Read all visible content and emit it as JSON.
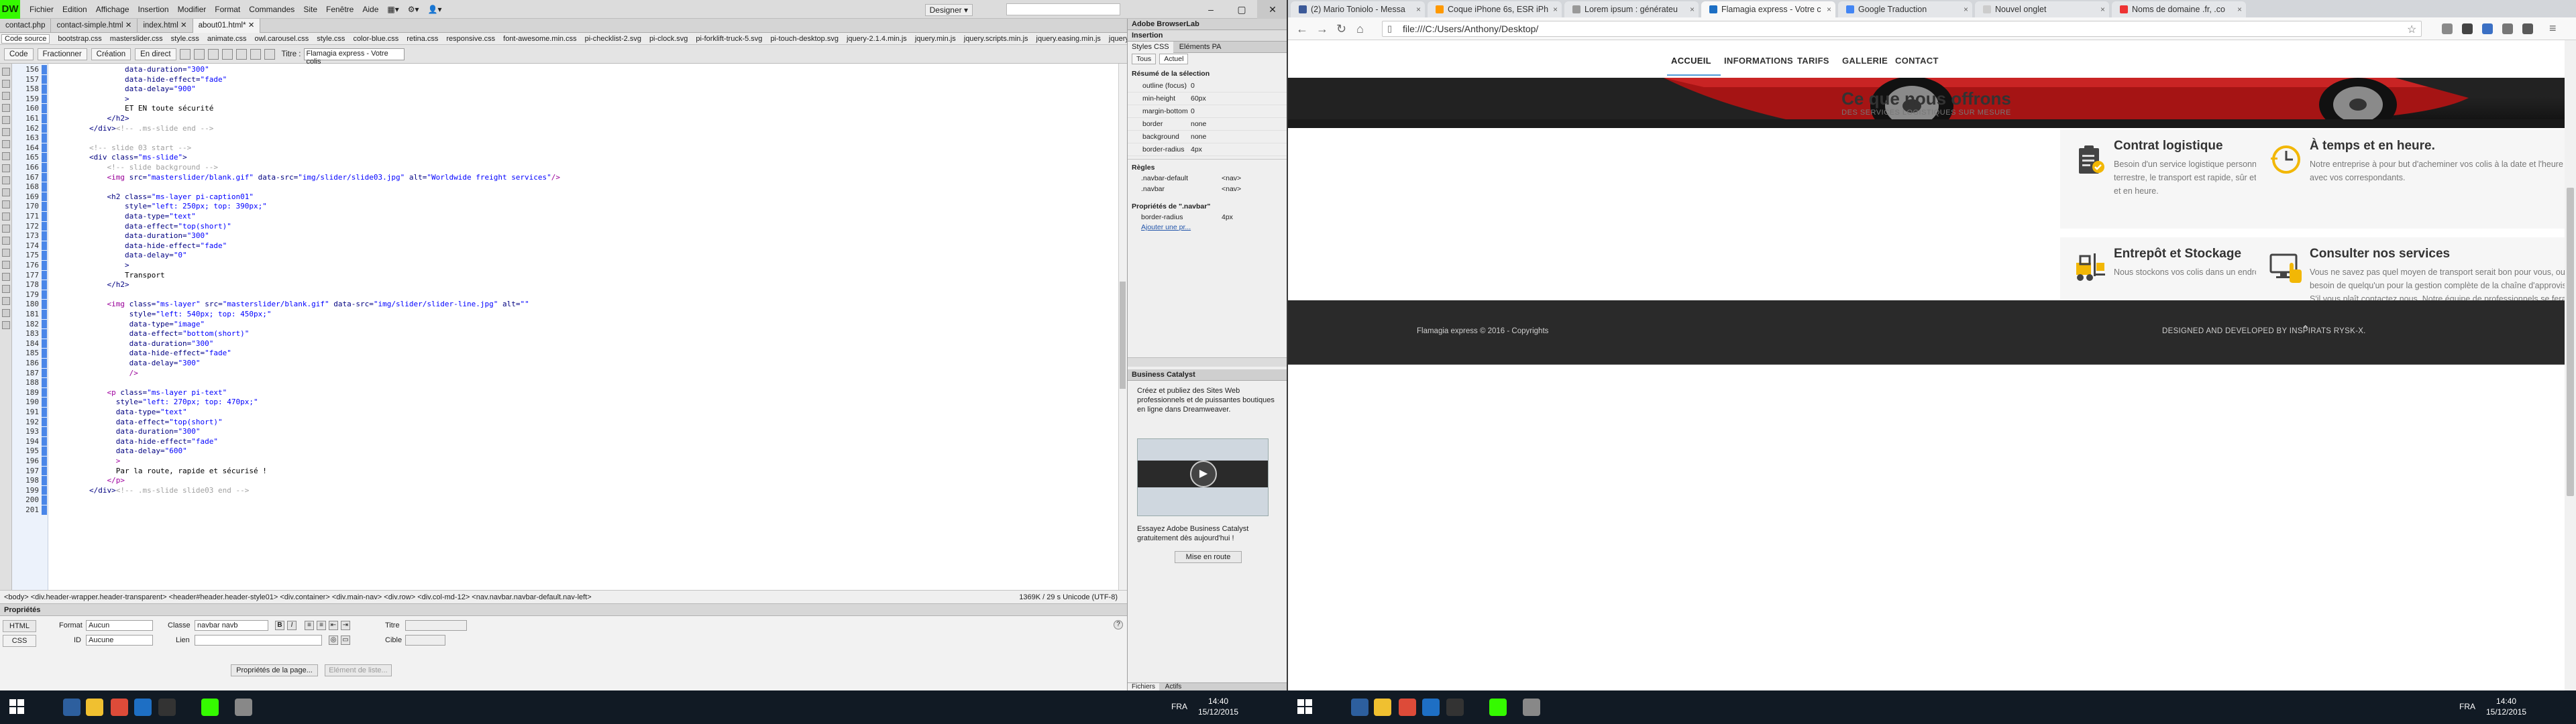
{
  "dreamweaver": {
    "logo": "DW",
    "menus": [
      "Fichier",
      "Edition",
      "Affichage",
      "Insertion",
      "Modifier",
      "Format",
      "Commandes",
      "Site",
      "Fenêtre",
      "Aide"
    ],
    "workspace": "Designer ▾",
    "window_controls": [
      "–",
      "▢",
      "✕"
    ],
    "doc_tabs": [
      "contact.php",
      "contact-simple.html ✕",
      "index.html ✕",
      "about01.html* ✕"
    ],
    "related_files": [
      "Code source",
      "bootstrap.css",
      "masterslider.css",
      "style.css",
      "animate.css",
      "owl.carousel.css",
      "style.css",
      "color-blue.css",
      "retina.css",
      "responsive.css",
      "font-awesome.min.css",
      "pi-checklist-2.svg",
      "pi-clock.svg",
      "pi-forklift-truck-5.svg",
      "pi-touch-desktop.svg",
      "jquery-2.1.4.min.js",
      "jquery.min.js",
      "jquery.scripts.min.js",
      "jquery.easing.min.js",
      "jquery.mcst"
    ],
    "view_buttons": [
      "Code",
      "Fractionner",
      "Création",
      "En direct"
    ],
    "title_label": "Titre :",
    "title_value": "Flamagia express - Votre colis",
    "code_lines": [
      {
        "n": "156",
        "c": [
          [
            "t-attr",
            "                data-duration="
          ],
          [
            "t-str",
            "\"300\""
          ]
        ]
      },
      {
        "n": "157",
        "c": [
          [
            "t-attr",
            "                data-hide-effect="
          ],
          [
            "t-str",
            "\"fade\""
          ]
        ]
      },
      {
        "n": "158",
        "c": [
          [
            "t-attr",
            "                data-delay="
          ],
          [
            "t-str",
            "\"900\""
          ]
        ]
      },
      {
        "n": "159",
        "c": [
          [
            "t-tag",
            "                >"
          ]
        ]
      },
      {
        "n": "160",
        "c": [
          [
            "t-txt",
            "                ET EN toute sécurité"
          ]
        ]
      },
      {
        "n": "161",
        "c": [
          [
            "t-tag",
            "            </h2>"
          ]
        ]
      },
      {
        "n": "162",
        "c": [
          [
            "t-tag",
            "        </div>"
          ],
          [
            "t-cmt",
            "<!-- .ms-slide end -->"
          ]
        ]
      },
      {
        "n": "163",
        "c": [
          [
            "t-txt",
            ""
          ]
        ]
      },
      {
        "n": "164",
        "c": [
          [
            "t-cmt",
            "        <!-- slide 03 start -->"
          ]
        ]
      },
      {
        "n": "165",
        "c": [
          [
            "t-tag",
            "        <div "
          ],
          [
            "t-attr",
            "class="
          ],
          [
            "t-str",
            "\"ms-slide\""
          ],
          [
            "t-tag",
            ">"
          ]
        ]
      },
      {
        "n": "166",
        "c": [
          [
            "t-cmt",
            "            <!-- slide background -->"
          ]
        ]
      },
      {
        "n": "167",
        "c": [
          [
            "t-img",
            "            <img "
          ],
          [
            "t-attr",
            "src="
          ],
          [
            "t-str",
            "\"masterslider/blank.gif\""
          ],
          [
            "t-attr",
            " data-src="
          ],
          [
            "t-str",
            "\"img/slider/slide03.jpg\""
          ],
          [
            "t-attr",
            " alt="
          ],
          [
            "t-str",
            "\"Worldwide freight services\""
          ],
          [
            "t-img",
            "/>"
          ]
        ]
      },
      {
        "n": "168",
        "c": [
          [
            "t-txt",
            ""
          ]
        ]
      },
      {
        "n": "169",
        "c": [
          [
            "t-tag",
            "            <h2 "
          ],
          [
            "t-attr",
            "class="
          ],
          [
            "t-str",
            "\"ms-layer pi-caption01\""
          ]
        ]
      },
      {
        "n": "170",
        "c": [
          [
            "t-attr",
            "                style="
          ],
          [
            "t-str",
            "\"left: 250px; top: 390px;\""
          ]
        ]
      },
      {
        "n": "171",
        "c": [
          [
            "t-attr",
            "                data-type="
          ],
          [
            "t-str",
            "\"text\""
          ]
        ]
      },
      {
        "n": "172",
        "c": [
          [
            "t-attr",
            "                data-effect="
          ],
          [
            "t-str",
            "\"top(short)\""
          ]
        ]
      },
      {
        "n": "173",
        "c": [
          [
            "t-attr",
            "                data-duration="
          ],
          [
            "t-str",
            "\"300\""
          ]
        ]
      },
      {
        "n": "174",
        "c": [
          [
            "t-attr",
            "                data-hide-effect="
          ],
          [
            "t-str",
            "\"fade\""
          ]
        ]
      },
      {
        "n": "175",
        "c": [
          [
            "t-attr",
            "                data-delay="
          ],
          [
            "t-str",
            "\"0\""
          ]
        ]
      },
      {
        "n": "176",
        "c": [
          [
            "t-tag",
            "                >"
          ]
        ]
      },
      {
        "n": "177",
        "c": [
          [
            "t-txt",
            "                Transport"
          ]
        ]
      },
      {
        "n": "178",
        "c": [
          [
            "t-tag",
            "            </h2>"
          ]
        ]
      },
      {
        "n": "179",
        "c": [
          [
            "t-txt",
            ""
          ]
        ]
      },
      {
        "n": "180",
        "c": [
          [
            "t-img",
            "            <img "
          ],
          [
            "t-attr",
            "class="
          ],
          [
            "t-str",
            "\"ms-layer\""
          ],
          [
            "t-attr",
            " src="
          ],
          [
            "t-str",
            "\"masterslider/blank.gif\""
          ],
          [
            "t-attr",
            " data-src="
          ],
          [
            "t-str",
            "\"img/slider/slider-line.jpg\""
          ],
          [
            "t-attr",
            " alt="
          ],
          [
            "t-str",
            "\"\""
          ]
        ]
      },
      {
        "n": "181",
        "c": [
          [
            "t-attr",
            "                 style="
          ],
          [
            "t-str",
            "\"left: 540px; top: 450px;\""
          ]
        ]
      },
      {
        "n": "182",
        "c": [
          [
            "t-attr",
            "                 data-type="
          ],
          [
            "t-str",
            "\"image\""
          ]
        ]
      },
      {
        "n": "183",
        "c": [
          [
            "t-attr",
            "                 data-effect="
          ],
          [
            "t-str",
            "\"bottom(short)\""
          ]
        ]
      },
      {
        "n": "184",
        "c": [
          [
            "t-attr",
            "                 data-duration="
          ],
          [
            "t-str",
            "\"300\""
          ]
        ]
      },
      {
        "n": "185",
        "c": [
          [
            "t-attr",
            "                 data-hide-effect="
          ],
          [
            "t-str",
            "\"fade\""
          ]
        ]
      },
      {
        "n": "186",
        "c": [
          [
            "t-attr",
            "                 data-delay="
          ],
          [
            "t-str",
            "\"300\""
          ]
        ]
      },
      {
        "n": "187",
        "c": [
          [
            "t-img",
            "                 />"
          ]
        ]
      },
      {
        "n": "188",
        "c": [
          [
            "t-txt",
            ""
          ]
        ]
      },
      {
        "n": "189",
        "c": [
          [
            "t-p",
            "            <p "
          ],
          [
            "t-attr",
            "class="
          ],
          [
            "t-str",
            "\"ms-layer pi-text\""
          ]
        ]
      },
      {
        "n": "190",
        "c": [
          [
            "t-attr",
            "              style="
          ],
          [
            "t-str",
            "\"left: 270px; top: 470px;\""
          ]
        ]
      },
      {
        "n": "191",
        "c": [
          [
            "t-attr",
            "              data-type="
          ],
          [
            "t-str",
            "\"text\""
          ]
        ]
      },
      {
        "n": "192",
        "c": [
          [
            "t-attr",
            "              data-effect="
          ],
          [
            "t-str",
            "\"top(short)\""
          ]
        ]
      },
      {
        "n": "193",
        "c": [
          [
            "t-attr",
            "              data-duration="
          ],
          [
            "t-str",
            "\"300\""
          ]
        ]
      },
      {
        "n": "194",
        "c": [
          [
            "t-attr",
            "              data-hide-effect="
          ],
          [
            "t-str",
            "\"fade\""
          ]
        ]
      },
      {
        "n": "195",
        "c": [
          [
            "t-attr",
            "              data-delay="
          ],
          [
            "t-str",
            "\"600\""
          ]
        ]
      },
      {
        "n": "196",
        "c": [
          [
            "t-p",
            "              >"
          ]
        ]
      },
      {
        "n": "197",
        "c": [
          [
            "t-txt",
            "              Par la route, rapide et sécurisé !"
          ]
        ]
      },
      {
        "n": "198",
        "c": [
          [
            "t-p",
            "            </p>"
          ]
        ]
      },
      {
        "n": "199",
        "c": [
          [
            "t-tag",
            "        </div>"
          ],
          [
            "t-cmt",
            "<!-- .ms-slide slide03 end -->"
          ]
        ]
      },
      {
        "n": "200",
        "c": [
          [
            "t-txt",
            ""
          ]
        ]
      },
      {
        "n": "201",
        "c": [
          [
            "t-txt",
            ""
          ]
        ]
      }
    ],
    "status_path": "<body> <div.header-wrapper.header-transparent> <header#header.header-style01> <div.container> <div.main-nav> <div.row> <div.col-md-12> <nav.navbar.navbar-default.nav-left>",
    "status_right": "1369K / 29 s  Unicode (UTF-8)",
    "properties": {
      "title": "Propriétés",
      "html_btn": "HTML",
      "css_btn": "CSS",
      "format_label": "Format",
      "format_value": "Aucun",
      "classe_label": "Classe",
      "classe_value": "navbar navb",
      "id_label": "ID",
      "id_value": "Aucune",
      "lien_label": "Lien",
      "titre_label": "Titre",
      "cible_label": "Cible",
      "page_props_btn": "Propriétés de la page...",
      "list_item_btn": "Elément de liste..."
    },
    "panels": {
      "header1": "Adobe BrowserLab",
      "header2": "Insertion",
      "tabs": [
        "Styles CSS",
        "Eléments PA"
      ],
      "subtabs": [
        "Tous",
        "Actuel"
      ],
      "summary_title": "Résumé de la sélection",
      "summary": [
        [
          "outline (focus)",
          "0"
        ],
        [
          "min-height",
          "60px"
        ],
        [
          "margin-bottom",
          "0"
        ],
        [
          "border",
          "none"
        ],
        [
          "background",
          "none"
        ],
        [
          "border-radius",
          "4px"
        ]
      ],
      "rules_title": "Règles",
      "rules": [
        [
          ".navbar-default",
          "<nav>"
        ],
        [
          ".navbar",
          "<nav>"
        ]
      ],
      "props_title": "Propriétés de \".navbar\"",
      "props_rows": [
        [
          "border-radius",
          "4px"
        ]
      ],
      "add_prop": "Ajouter une pr...",
      "bc_title": "Business Catalyst",
      "bc_text": "Créez et publiez des Sites Web professionnels et de puissantes boutiques en ligne dans Dreamweaver.",
      "bc_try": "Essayez Adobe Business Catalyst gratuitement dès aujourd'hui !",
      "bc_button": "Mise en route",
      "files_tab": "Fichiers",
      "assets_tab": "Actifs"
    }
  },
  "browser": {
    "tabs": [
      {
        "label": "(2) Mario Toniolo - Messa",
        "color": "#3b5998"
      },
      {
        "label": "Coque iPhone 6s, ESR iPh",
        "color": "#f90"
      },
      {
        "label": "Lorem ipsum : générateu",
        "color": "#999"
      },
      {
        "label": "Flamagia express - Votre c",
        "color": "#1d6fc4"
      },
      {
        "label": "Google Traduction",
        "color": "#4285f4"
      },
      {
        "label": "Nouvel onglet",
        "color": "#ccc"
      },
      {
        "label": "Noms de domaine .fr, .co",
        "color": "#e33"
      }
    ],
    "url": "file:///C:/Users/Anthony/Desktop/",
    "nav": [
      "ACCUEIL",
      "INFORMATIONS",
      "TARIFS",
      "GALLERIE",
      "CONTACT"
    ],
    "section_title": "Ce que nous offrons",
    "section_subtitle": "DES SERVICES LOGISTIQUES SUR MESURE",
    "services": [
      {
        "title": "Contrat logistique",
        "text": "Besoin d'un service logistique personnalisé? Nous l'avons pour vous. Par voie terrestre, le transport est rapide, sûr et précis. Nous apportons votre colis en temps et en heure.",
        "icon": "clipboard-check-icon"
      },
      {
        "title": "À temps et en heure.",
        "text": "Notre entreprise à pour but d'acheminer vos colis à la date et l'heure souhaitée avec vos correspondants.",
        "icon": "clock-icon"
      },
      {
        "title": "Entrepôt et Stockage",
        "text": "Nous stockons vos colis dans un endroit sécurisé et très bien entretenue",
        "icon": "forklift-icon"
      },
      {
        "title": "Consulter nos services",
        "text": "Vous ne savez pas quel moyen de transport                     serait bon pour vous, ou si vous avez besoin de quelqu'un                          pour la gestion complète de la chaîne d'approvisionnement? S'il vous plaît contactez                  nous. Notre équipe de professionnels se fera un plaisir de vous aider.",
        "icon": "touch-desktop-icon"
      }
    ],
    "footer_copy": "Flamagia express © 2016 - Copyrights",
    "footer_dev": "DESIGNED AND DEVELOPED BY INSPIRATS RYSK-X.",
    "footer_top": "⌃"
  },
  "taskbar": {
    "left": {
      "time": "14:40",
      "date": "15/12/2015",
      "lang": "FRA"
    },
    "right": {
      "time": "14:40",
      "date": "15/12/2015",
      "lang": "FRA"
    }
  }
}
